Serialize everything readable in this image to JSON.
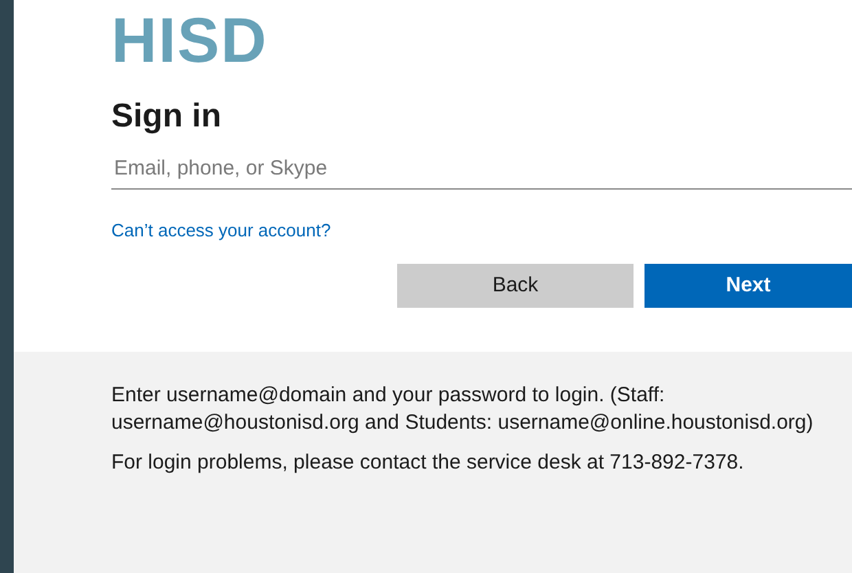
{
  "logo": "HISD",
  "title": "Sign in",
  "email_field": {
    "placeholder": "Email, phone, or Skype"
  },
  "link": "Can’t access your account?",
  "buttons": [
    {
      "label": "Back",
      "kind": "secondary"
    },
    {
      "label": "Next",
      "kind": "primary"
    }
  ],
  "info": [
    "Enter username@domain and your password to login. (Staff: username@houstonisd.org and Students: username@online.houstonisd.org)",
    "For login problems, please contact the service desk at 713-892-7378."
  ]
}
